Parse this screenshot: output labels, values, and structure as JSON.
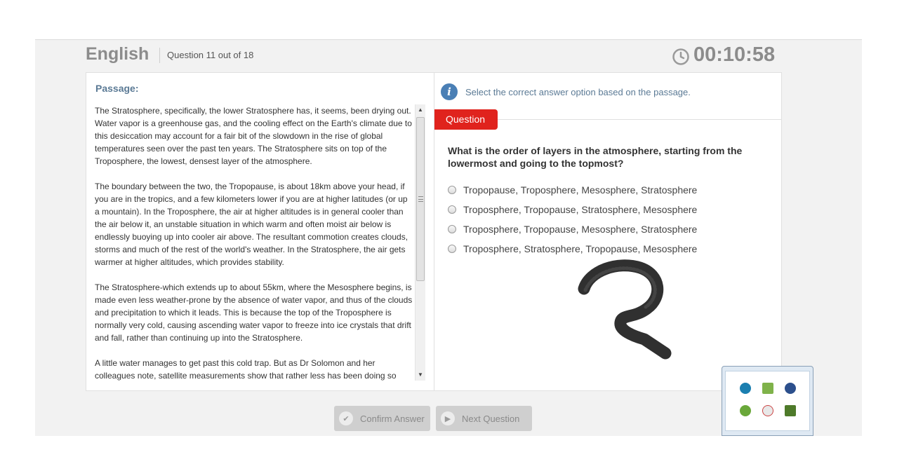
{
  "header": {
    "subject": "English",
    "question_counter": "Question 11 out of 18",
    "timer": "00:10:58"
  },
  "passage": {
    "title": "Passage:",
    "paragraphs": [
      "The Stratosphere, specifically, the lower Stratosphere has, it seems, been drying out. Water vapor is a greenhouse gas, and the cooling effect on the Earth's climate due to this desiccation may account for a fair bit of the slowdown in the rise of global temperatures seen over the past ten years. The Stratosphere sits on top of the Troposphere, the lowest, densest layer of the atmosphere.",
      "The boundary between the two, the Tropopause, is about 18km above your head, if you are in the tropics, and a few kilometers lower if you are at higher latitudes (or up a mountain). In the Troposphere, the air at higher altitudes is in general cooler than the air below it, an unstable situation in which warm and often moist air below is endlessly buoying up into cooler air above. The resultant commotion creates clouds, storms and much of the rest of the world's weather. In the Stratosphere, the air gets warmer at higher altitudes, which provides stability.",
      "The Stratosphere-which extends up to about 55km, where the Mesosphere begins, is made even less weather-prone by the absence of water vapor, and thus of the clouds and precipitation to which it leads. This is because the top of the Troposphere is normally very cold, causing ascending water vapor to freeze into ice crystals that drift and fall, rather than continuing up into the Stratosphere.",
      "A little water manages to get past this cold trap. But as Dr Solomon and her colleagues note, satellite measurements show that rather less has been doing so"
    ]
  },
  "question_panel": {
    "instruction": "Select the correct answer option based on the passage.",
    "tab_label": "Question",
    "question": "What is the order of layers in the atmosphere, starting from the lowermost and going to the topmost?",
    "options": [
      "Tropopause, Troposphere, Mesosphere, Stratosphere",
      "Troposphere, Tropopause, Stratosphere, Mesosphere",
      "Troposphere, Tropopause, Mesosphere, Stratosphere",
      "Troposphere, Stratosphere, Tropopause, Mesosphere"
    ]
  },
  "buttons": {
    "confirm": "Confirm Answer",
    "next": "Next Question"
  },
  "icons": {
    "timer": "clock-icon",
    "info": "info-icon",
    "confirm": "check-circle-icon",
    "next": "play-circle-icon"
  },
  "colors": {
    "accent_red": "#e0231d",
    "info_blue": "#4a7fb5",
    "label_blue": "#5b7a95"
  }
}
